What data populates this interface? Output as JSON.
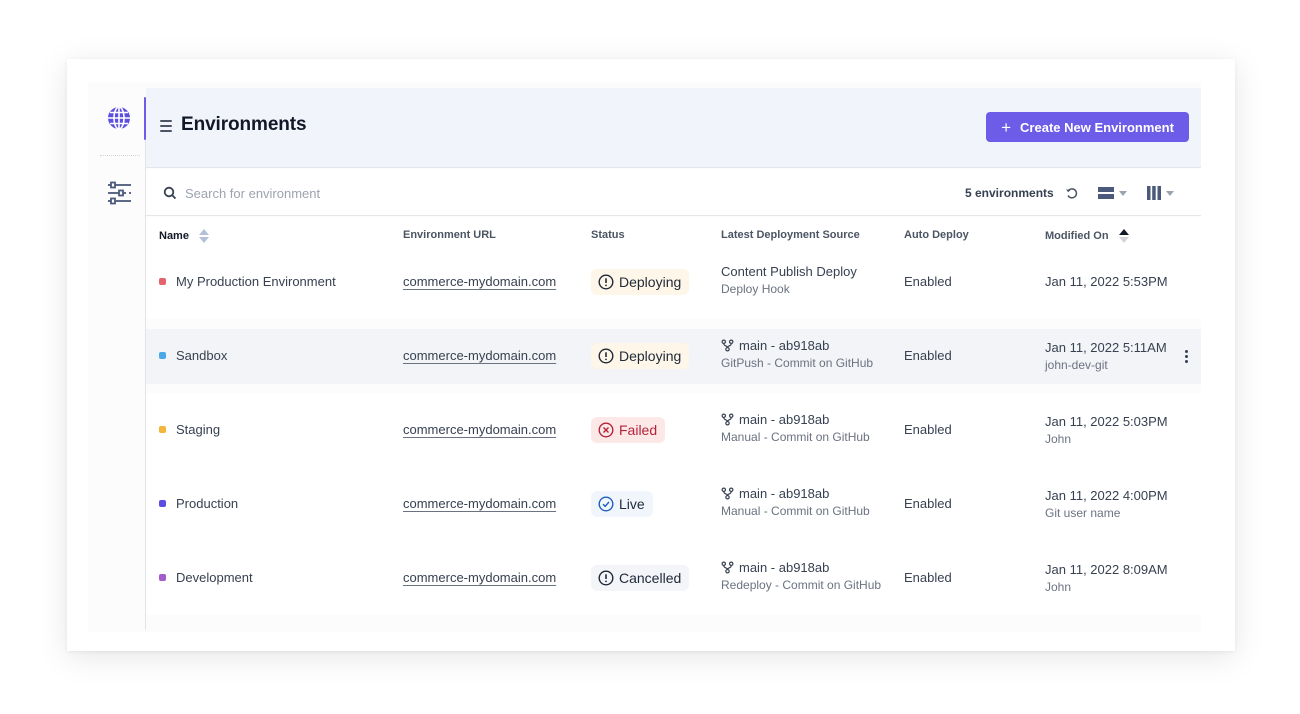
{
  "sidebar": {
    "items": [
      {
        "icon": "globe-icon",
        "active": true
      },
      {
        "icon": "filters-icon",
        "active": false
      }
    ]
  },
  "header": {
    "title": "Environments",
    "create_button_label": "Create New Environment"
  },
  "toolbar": {
    "search_placeholder": "Search for environment",
    "search_value": "",
    "count_label": "5 environments"
  },
  "colors": {
    "accent": "#6c5ce7",
    "deploying_bg": "#fdf6e9",
    "failed_bg": "#fde8e8",
    "failed_text": "#b4233a",
    "live_bg": "#f1f6fd",
    "live_icon": "#1f5fbf",
    "cancelled_bg": "#f3f5f9"
  },
  "table": {
    "columns": [
      {
        "label": "Name",
        "sortable": true,
        "sort": "none"
      },
      {
        "label": "Environment URL"
      },
      {
        "label": "Status"
      },
      {
        "label": "Latest Deployment Source"
      },
      {
        "label": "Auto Deploy"
      },
      {
        "label": "Modified On",
        "sortable": true,
        "sort": "ascending"
      }
    ],
    "rows": [
      {
        "color": "#e5636b",
        "name": "My Production Environment",
        "url": "commerce-mydomain.com",
        "status": "Deploying",
        "source_main": "Content Publish Deploy",
        "source_sub": "Deploy Hook",
        "source_branch_icon": false,
        "auto_deploy": "Enabled",
        "modified": "Jan 11, 2022 5:53PM",
        "modified_by": ""
      },
      {
        "color": "#4aa8e8",
        "name": "Sandbox",
        "url": "commerce-mydomain.com",
        "status": "Deploying",
        "source_main": "main - ab918ab",
        "source_sub": "GitPush - Commit on GitHub",
        "source_branch_icon": true,
        "auto_deploy": "Enabled",
        "modified": "Jan 11, 2022 5:11AM",
        "modified_by": "john-dev-git"
      },
      {
        "color": "#f2b63a",
        "name": "Staging",
        "url": "commerce-mydomain.com",
        "status": "Failed",
        "source_main": "main - ab918ab",
        "source_sub": "Manual - Commit on GitHub",
        "source_branch_icon": true,
        "auto_deploy": "Enabled",
        "modified": "Jan 11, 2022 5:03PM",
        "modified_by": "John"
      },
      {
        "color": "#5b4ee0",
        "name": "Production",
        "url": "commerce-mydomain.com",
        "status": "Live",
        "source_main": "main - ab918ab",
        "source_sub": "Manual - Commit on GitHub",
        "source_branch_icon": true,
        "auto_deploy": "Enabled",
        "modified": "Jan 11, 2022 4:00PM",
        "modified_by": "Git user name"
      },
      {
        "color": "#a35cc9",
        "name": "Development",
        "url": "commerce-mydomain.com",
        "status": "Cancelled",
        "source_main": "main - ab918ab",
        "source_sub": "Redeploy - Commit on GitHub",
        "source_branch_icon": true,
        "auto_deploy": "Enabled",
        "modified": "Jan 11, 2022 8:09AM",
        "modified_by": "John"
      }
    ]
  }
}
